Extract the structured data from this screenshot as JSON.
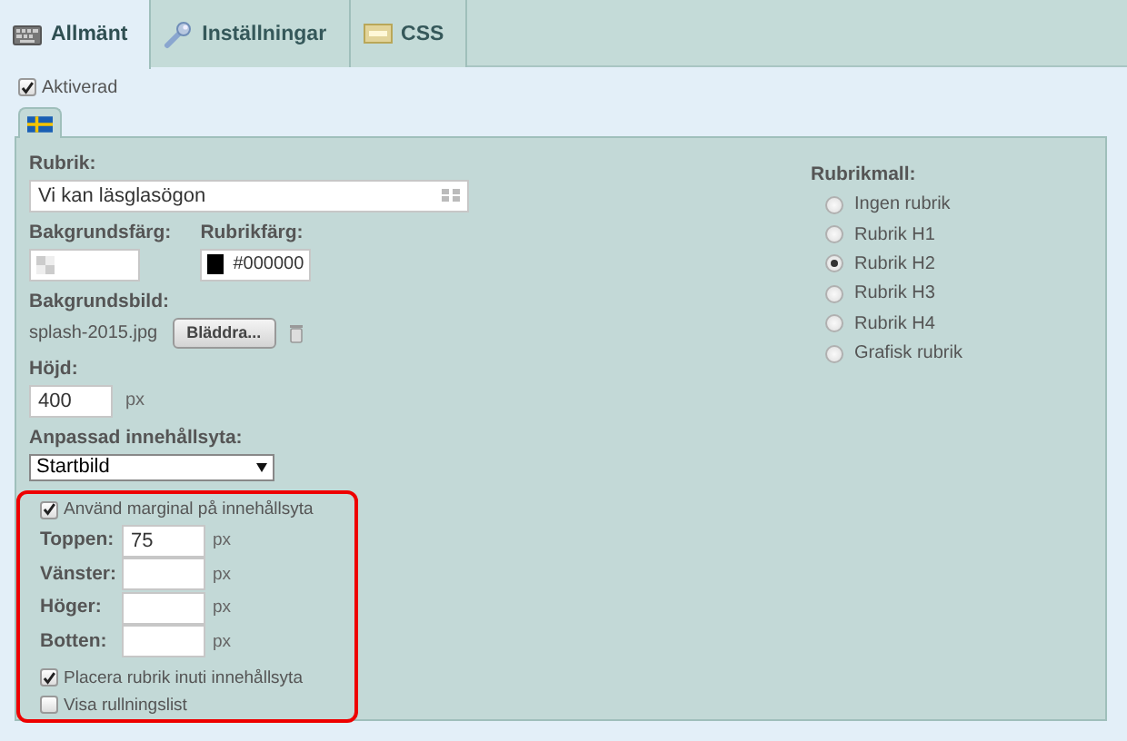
{
  "tabs": [
    {
      "label": "Allmänt",
      "selected": true
    },
    {
      "label": "Inställningar",
      "selected": false
    },
    {
      "label": "CSS",
      "selected": false
    }
  ],
  "enabled": {
    "label": "Aktiverad",
    "checked": true
  },
  "form": {
    "heading": {
      "label": "Rubrik:",
      "value": "Vi kan läsglasögon"
    },
    "background_color": {
      "label": "Bakgrundsfärg:"
    },
    "heading_color": {
      "label": "Rubrikfärg:",
      "value": "#000000"
    },
    "background_image": {
      "label": "Bakgrundsbild:",
      "file": "splash-2015.jpg",
      "button": "Bläddra..."
    },
    "height": {
      "label": "Höjd:",
      "value": "400",
      "unit": "px"
    },
    "content_area": {
      "label": "Anpassad innehållsyta:",
      "value": "Startbild"
    },
    "margins": {
      "use": {
        "label": "Använd marginal på innehållsyta",
        "checked": true
      },
      "fields": [
        {
          "label": "Toppen:",
          "value": "75",
          "unit": "px"
        },
        {
          "label": "Vänster:",
          "unit": "px"
        },
        {
          "label": "Höger:",
          "unit": "px"
        },
        {
          "label": "Botten:",
          "unit": "px"
        }
      ],
      "options": [
        {
          "label": "Placera rubrik inuti innehållsyta",
          "checked": true
        },
        {
          "label": "Visa rullningslist",
          "checked": false
        }
      ]
    }
  },
  "heading_template": {
    "label": "Rubrikmall:",
    "options": [
      {
        "label": "Ingen rubrik",
        "selected": false
      },
      {
        "label": "Rubrik H1",
        "selected": false
      },
      {
        "label": "Rubrik H2",
        "selected": true
      },
      {
        "label": "Rubrik H3",
        "selected": false
      },
      {
        "label": "Rubrik H4",
        "selected": false
      },
      {
        "label": "Grafisk rubrik",
        "selected": false
      }
    ]
  }
}
